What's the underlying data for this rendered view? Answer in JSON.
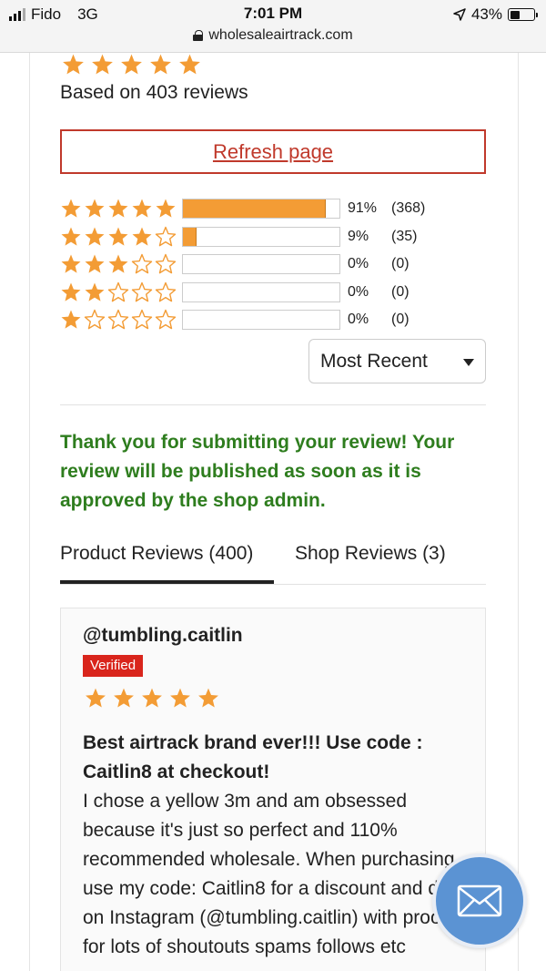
{
  "status_bar": {
    "carrier": "Fido",
    "network": "3G",
    "time": "7:01 PM",
    "battery": "43%",
    "battery_level": 0.43,
    "url": "wholesaleairtrack.com"
  },
  "summary": {
    "rating": 5,
    "based_on": "Based on 403 reviews",
    "refresh_label": "Refresh page"
  },
  "histogram": [
    {
      "stars": 5,
      "fraction": 0.91,
      "pct": "91%",
      "count": "(368)"
    },
    {
      "stars": 4,
      "fraction": 0.09,
      "pct": "9%",
      "count": "(35)"
    },
    {
      "stars": 3,
      "fraction": 0,
      "pct": "0%",
      "count": "(0)"
    },
    {
      "stars": 2,
      "fraction": 0,
      "pct": "0%",
      "count": "(0)"
    },
    {
      "stars": 1,
      "fraction": 0,
      "pct": "0%",
      "count": "(0)"
    }
  ],
  "sort": {
    "selected": "Most Recent"
  },
  "thanks_message": "Thank you for submitting your review! Your review will be published as soon as it is approved by the shop admin.",
  "tabs": [
    {
      "label": "Product Reviews (400)",
      "active": true
    },
    {
      "label": "Shop Reviews (3)",
      "active": false
    }
  ],
  "review": {
    "author": "@tumbling.caitlin",
    "badge": "Verified",
    "rating": 5,
    "title": "Best airtrack brand ever!!! Use code : Caitlin8 at checkout!",
    "body": "I chose a yellow 3m and am obsessed because it's just so perfect and 110% recommended wholesale. When purchasing use my code: Caitlin8 for a discount and dm on Instagram (@tumbling.caitlin) with proof for lots of shoutouts spams follows etc"
  },
  "colors": {
    "star": "#f39c35",
    "bar_fill": "#f39c35",
    "refresh_border": "#c0392b",
    "thanks_text": "#2e7d1e",
    "verified_bg": "#d9251c",
    "mail_button": "#5b93d3"
  },
  "icons": {
    "mail": "envelope-icon",
    "star": "star-icon",
    "lock": "lock-icon",
    "location": "location-arrow-icon"
  }
}
